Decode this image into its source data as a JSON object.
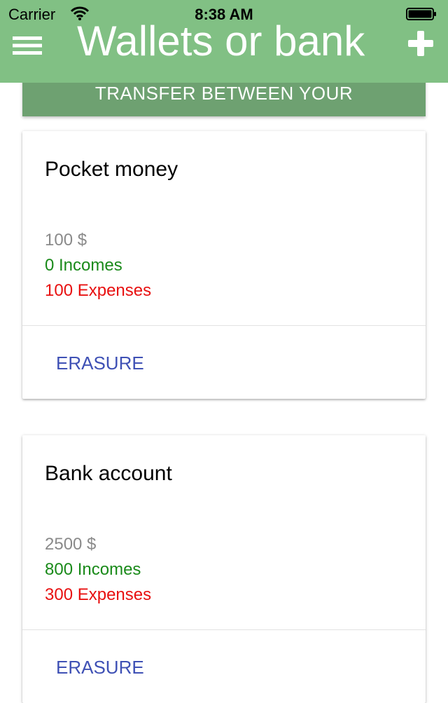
{
  "status_bar": {
    "carrier": "Carrier",
    "time": "8:38 AM"
  },
  "header": {
    "title": "Wallets or bank",
    "menu_icon": "hamburger-menu-icon",
    "add_icon": "plus-icon",
    "background_color": "#81c084"
  },
  "transfer_button": {
    "label": "TRANSFER BETWEEN YOUR"
  },
  "accounts": [
    {
      "name": "Pocket money",
      "balance": "100 $",
      "incomes": "0 Incomes",
      "expenses": "100 Expenses",
      "action_label": "ERASURE"
    },
    {
      "name": "Bank account",
      "balance": "2500 $",
      "incomes": "800 Incomes",
      "expenses": "300 Expenses",
      "action_label": "ERASURE"
    }
  ],
  "colors": {
    "income": "#1a8a1a",
    "expense": "#e81010",
    "action": "#3f51b5",
    "balance": "#8a8a8a"
  }
}
